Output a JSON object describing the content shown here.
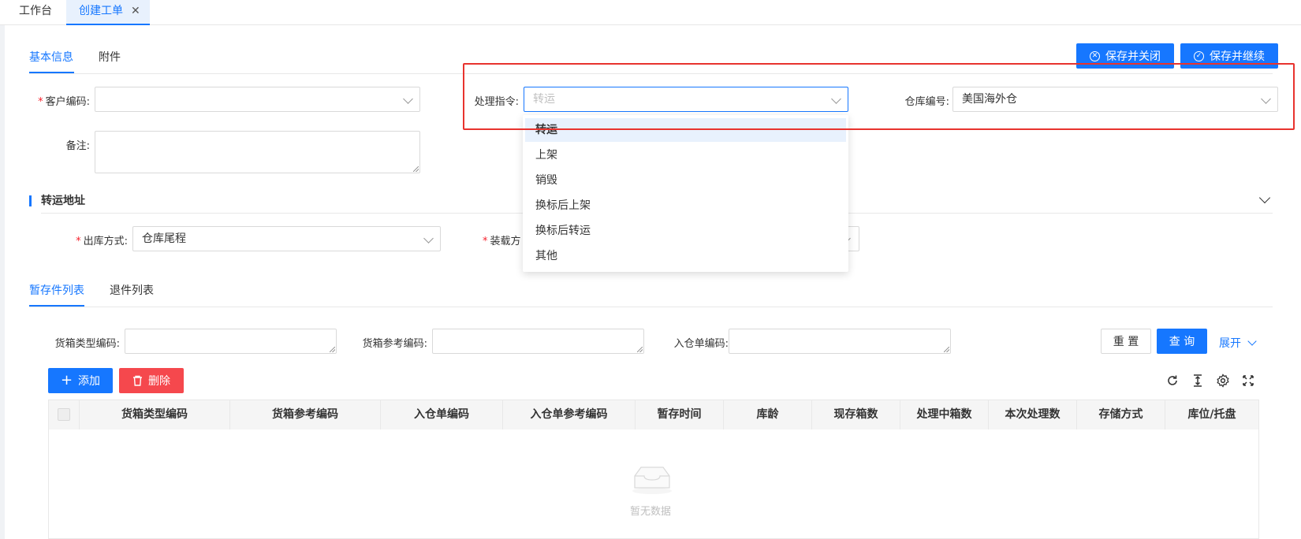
{
  "tabs": [
    {
      "label": "工作台"
    },
    {
      "label": "创建工单",
      "close": "✕"
    }
  ],
  "subtabs": {
    "basic": "基本信息",
    "attach": "附件"
  },
  "actions": {
    "save_close": "保存并关闭",
    "save_continue": "保存并继续"
  },
  "form": {
    "customer_code": {
      "label": "客户编码:",
      "value": ""
    },
    "instruction": {
      "label": "处理指令:",
      "placeholder": "转运"
    },
    "warehouse": {
      "label": "仓库编号:",
      "value": "美国海外仓"
    },
    "remark": {
      "label": "备注:"
    }
  },
  "dropdown": {
    "options": [
      "转运",
      "上架",
      "销毁",
      "换标后上架",
      "换标后转运",
      "其他"
    ],
    "selected": "转运"
  },
  "transfer": {
    "title": "转运地址",
    "outbound": {
      "label": "出库方式:",
      "value": "仓库尾程"
    },
    "loading": {
      "label": "装载方"
    }
  },
  "list_tabs": {
    "temp": "暂存件列表",
    "return": "退件列表"
  },
  "filters": {
    "box_type": "货箱类型编码:",
    "box_ref": "货箱参考编码:",
    "inbound_no": "入仓单编码:",
    "reset": "重 置",
    "query": "查 询",
    "expand": "展开"
  },
  "toolbar": {
    "add": "添加",
    "delete": "删除"
  },
  "table": {
    "columns": [
      "货箱类型编码",
      "货箱参考编码",
      "入仓单编码",
      "入仓单参考编码",
      "暂存时间",
      "库龄",
      "现存箱数",
      "处理中箱数",
      "本次处理数",
      "存储方式",
      "库位/托盘"
    ],
    "empty": "暂无数据"
  },
  "colors": {
    "primary": "#1677ff",
    "danger": "#f5484d",
    "highlight": "#e8332e"
  }
}
